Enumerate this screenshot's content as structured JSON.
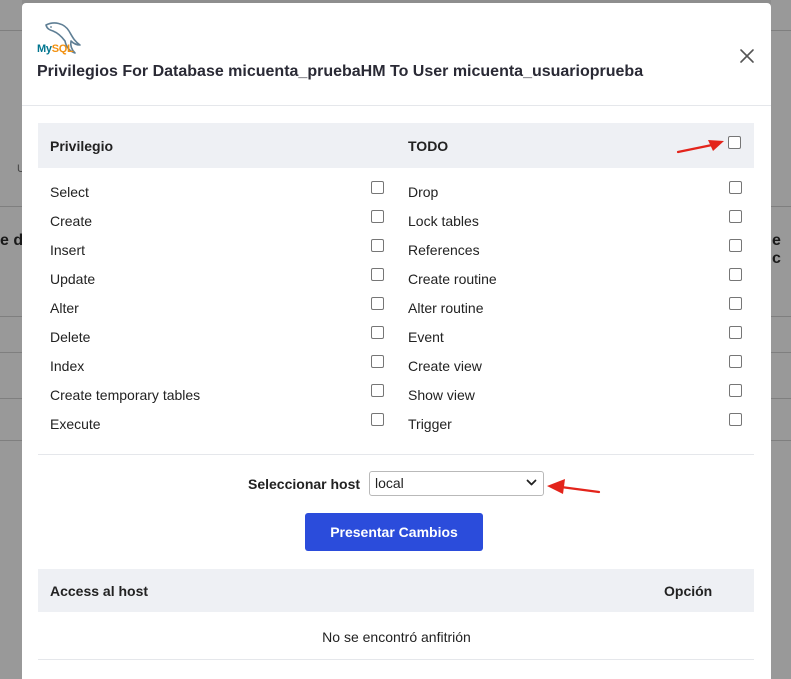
{
  "background": {
    "fragment_left": "e d",
    "fragment_right": "e c",
    "fragment_small": "U"
  },
  "logo": {
    "my": "My",
    "sql": "SQL"
  },
  "modal": {
    "title": "Privilegios For Database micuenta_pruebaHM To User micuenta_usuarioprueba",
    "close_icon": "close-icon"
  },
  "privileges": {
    "header_left": "Privilegio",
    "header_right": "TODO",
    "left": [
      "Select",
      "Create",
      "Insert",
      "Update",
      "Alter",
      "Delete",
      "Index",
      "Create temporary tables",
      "Execute"
    ],
    "right": [
      "Drop",
      "Lock tables",
      "References",
      "Create routine",
      "Alter routine",
      "Event",
      "Create view",
      "Show view",
      "Trigger"
    ]
  },
  "host": {
    "label": "Seleccionar host",
    "selected": "local"
  },
  "submit_label": "Presentar Cambios",
  "host_table": {
    "col_access": "Access al host",
    "col_option": "Opción",
    "empty": "No se encontró anfitrión"
  },
  "colors": {
    "primary": "#2b4cdb",
    "annotation_arrow": "#e3241b",
    "header_bg": "#eef0f4"
  }
}
